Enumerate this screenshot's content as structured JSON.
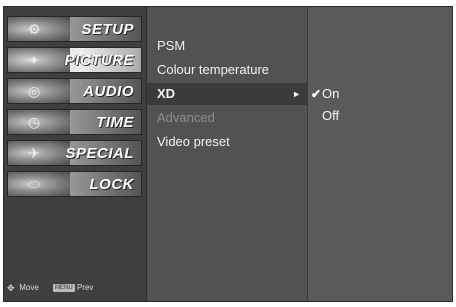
{
  "sidebar": {
    "categories": [
      {
        "label": "SETUP",
        "icon": "setup-icon",
        "glyph": "⚙"
      },
      {
        "label": "PICTURE",
        "icon": "picture-icon",
        "glyph": "✦"
      },
      {
        "label": "AUDIO",
        "icon": "audio-icon",
        "glyph": "◎"
      },
      {
        "label": "TIME",
        "icon": "time-icon",
        "glyph": "◷"
      },
      {
        "label": "SPECIAL",
        "icon": "special-icon",
        "glyph": "✈"
      },
      {
        "label": "LOCK",
        "icon": "lock-icon",
        "glyph": "⬭"
      }
    ],
    "selected": "PICTURE"
  },
  "footer": {
    "move_label": "Move",
    "menu_key": "MENU",
    "prev_label": "Prev"
  },
  "menu_items": [
    {
      "label": "PSM"
    },
    {
      "label": "Colour temperature"
    },
    {
      "label": "XD",
      "arrow": "►"
    },
    {
      "label": "Advanced"
    },
    {
      "label": "Video preset"
    }
  ],
  "selected_item": "XD",
  "options": [
    {
      "label": "On",
      "checked": true,
      "check": "✔"
    },
    {
      "label": "Off",
      "checked": false
    }
  ],
  "colors": {
    "panel_bg": "#4d4d4d",
    "selected_row": "#3b3b3b",
    "disabled_text": "#8e8e8e"
  }
}
